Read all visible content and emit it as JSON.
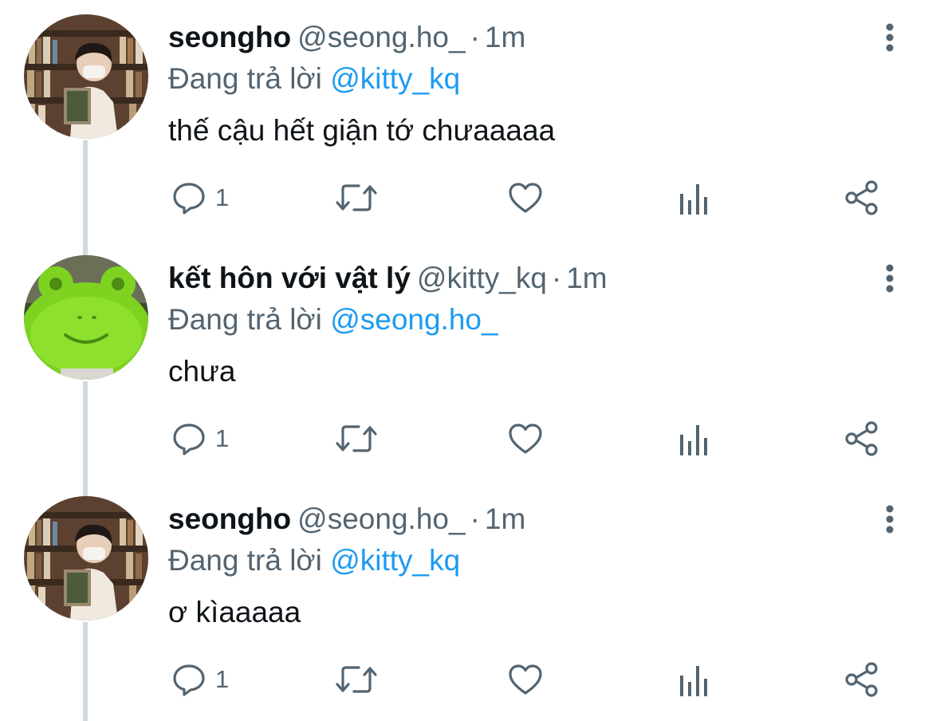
{
  "thread": {
    "tweets": [
      {
        "display_name": "seongho",
        "handle": "@seong.ho_",
        "separator": "·",
        "time": "1m",
        "reply_prefix": "Đang trả lời",
        "reply_to": "@kitty_kq",
        "text": "thế cậu hết giận tớ chưaaaaa",
        "reply_count": "1",
        "avatar_icon": "avatar-boy-bookshelf-photo"
      },
      {
        "display_name": "kết hôn với vật lý",
        "handle": "@kitty_kq",
        "separator": "·",
        "time": "1m",
        "reply_prefix": "Đang trả lời",
        "reply_to": "@seong.ho_",
        "text": "chưa",
        "reply_count": "1",
        "avatar_icon": "avatar-green-frog-plush-photo"
      },
      {
        "display_name": "seongho",
        "handle": "@seong.ho_",
        "separator": "·",
        "time": "1m",
        "reply_prefix": "Đang trả lời",
        "reply_to": "@kitty_kq",
        "text": "ơ kìaaaaa",
        "reply_count": "1",
        "avatar_icon": "avatar-boy-bookshelf-photo"
      }
    ]
  },
  "icons": {
    "reply": "reply-bubble-icon",
    "retweet": "retweet-icon",
    "like": "heart-icon",
    "views": "views-chart-icon",
    "share": "share-icon",
    "more": "more-vertical-icon"
  },
  "colors": {
    "text_primary": "#0f1419",
    "text_secondary": "#536471",
    "mention": "#1d9bf0",
    "thread_line": "#cfd9de",
    "background": "#ffffff"
  }
}
